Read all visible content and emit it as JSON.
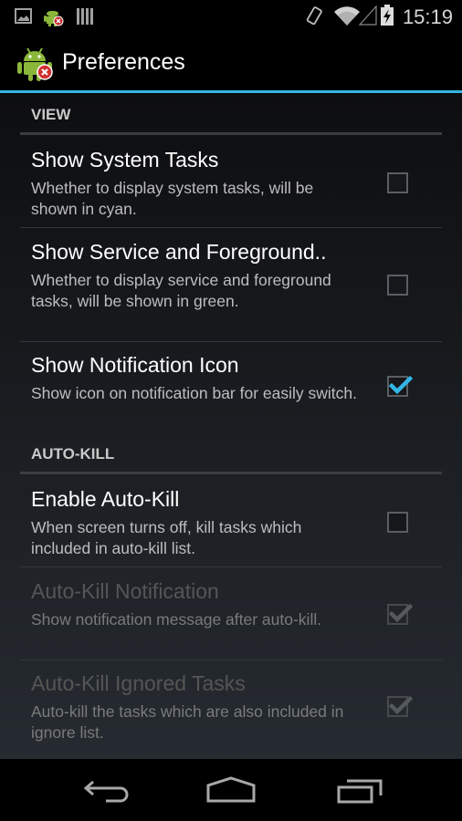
{
  "status_bar": {
    "time": "15:19",
    "left_icons": [
      "image-icon",
      "android-app-icon",
      "barcode-icon"
    ],
    "right_icons": [
      "vibrate-icon",
      "wifi-icon",
      "signal-icon",
      "battery-charging-icon"
    ]
  },
  "action_bar": {
    "title": "Preferences",
    "icon": "android-killer-icon"
  },
  "accent_color": "#33b5e5",
  "categories": [
    {
      "label": "VIEW",
      "preferences": [
        {
          "title": "Show System Tasks",
          "summary": "Whether to display system tasks, will be shown in cyan.",
          "checked": false,
          "enabled": true
        },
        {
          "title": "Show Service and Foreground..",
          "summary": "Whether to display service and foreground tasks, will be shown in green.",
          "checked": false,
          "enabled": true
        },
        {
          "title": "Show Notification Icon",
          "summary": "Show icon on notification bar for easily switch.",
          "checked": true,
          "enabled": true
        }
      ]
    },
    {
      "label": "AUTO-KILL",
      "preferences": [
        {
          "title": "Enable Auto-Kill",
          "summary": "When screen turns off, kill tasks which included in auto-kill list.",
          "checked": false,
          "enabled": true
        },
        {
          "title": "Auto-Kill Notification",
          "summary": "Show notification message after auto-kill.",
          "checked": true,
          "enabled": false
        },
        {
          "title": "Auto-Kill Ignored Tasks",
          "summary": "Auto-kill the tasks which are also included in ignore list.",
          "checked": true,
          "enabled": false
        }
      ]
    }
  ],
  "nav_bar": {
    "buttons": [
      "back",
      "home",
      "recents"
    ]
  }
}
